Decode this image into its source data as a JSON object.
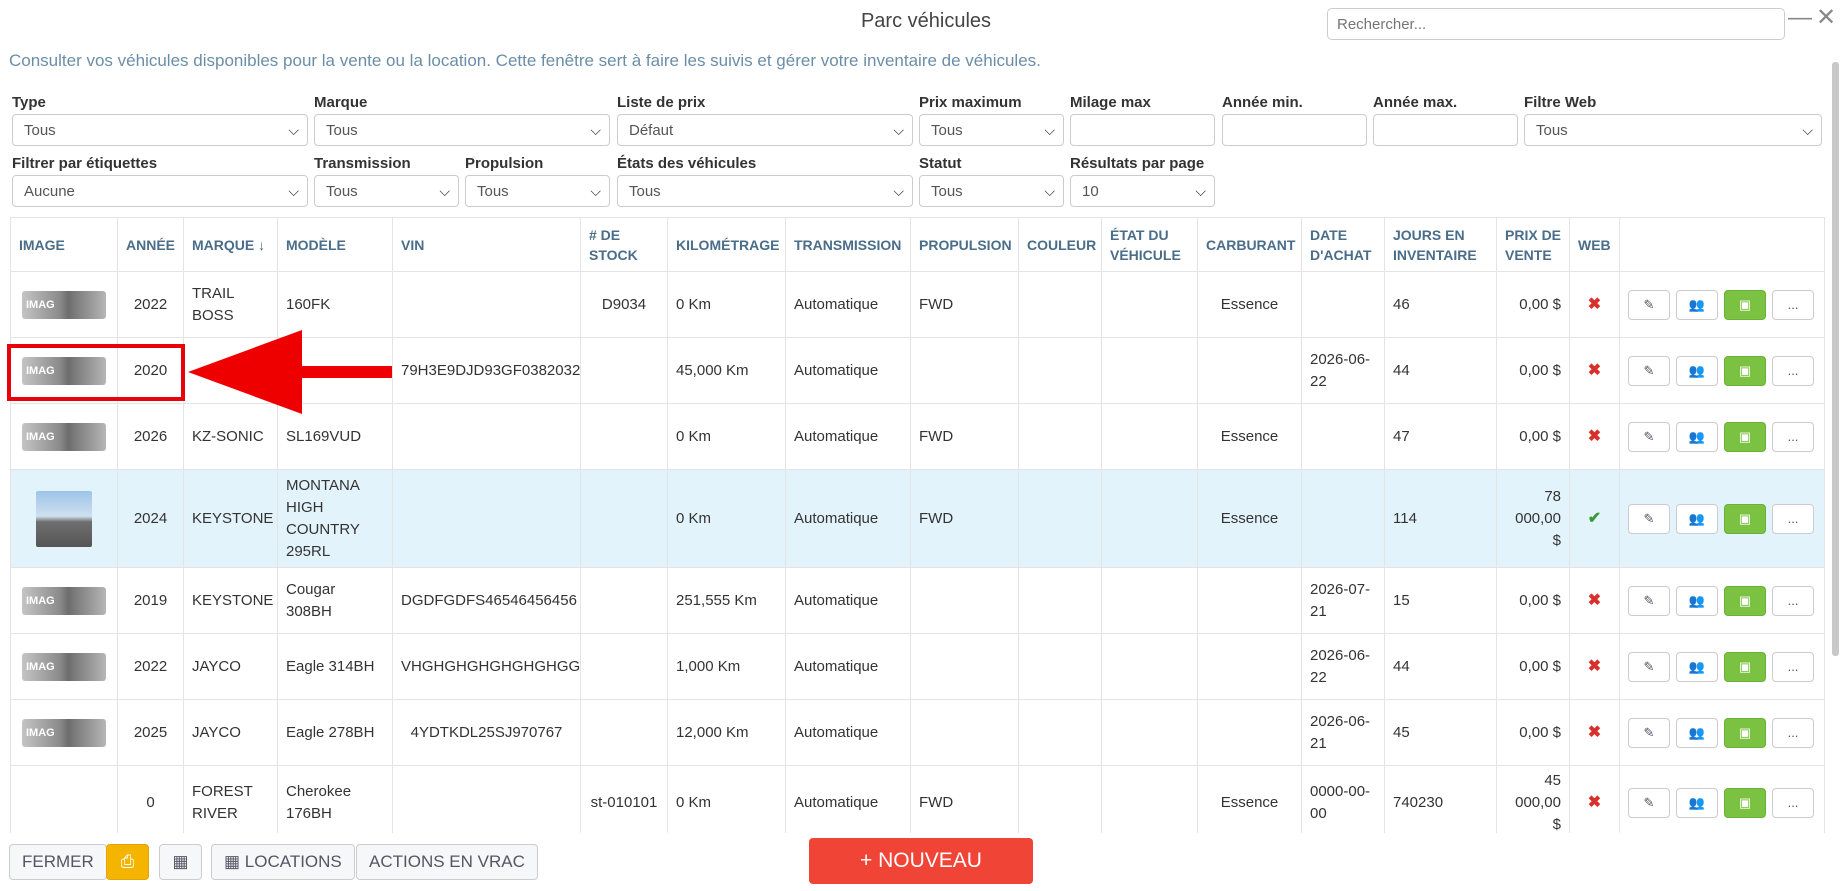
{
  "window": {
    "title": "Parc véhicules",
    "search_placeholder": "Rechercher...",
    "minimize": "—",
    "close": "✕"
  },
  "description": "Consulter vos véhicules disponibles pour la vente ou la location. Cette fenêtre sert à faire les suivis et gérer votre inventaire de véhicules.",
  "filters": {
    "type": {
      "label": "Type",
      "value": "Tous"
    },
    "marque": {
      "label": "Marque",
      "value": "Tous"
    },
    "liste_prix": {
      "label": "Liste de prix",
      "value": "Défaut"
    },
    "prix_max": {
      "label": "Prix maximum",
      "value": "Tous"
    },
    "milage_max": {
      "label": "Milage max",
      "value": ""
    },
    "annee_min": {
      "label": "Année min.",
      "value": ""
    },
    "annee_max": {
      "label": "Année max.",
      "value": ""
    },
    "filtre_web": {
      "label": "Filtre Web",
      "value": "Tous"
    },
    "etiquettes": {
      "label": "Filtrer par étiquettes",
      "value": "Aucune"
    },
    "transmission": {
      "label": "Transmission",
      "value": "Tous"
    },
    "propulsion": {
      "label": "Propulsion",
      "value": "Tous"
    },
    "etats": {
      "label": "États des véhicules",
      "value": "Tous"
    },
    "statut": {
      "label": "Statut",
      "value": "Tous"
    },
    "resultats": {
      "label": "Résultats par page",
      "value": "10"
    }
  },
  "table": {
    "headers": [
      "IMAGE",
      "ANNÉE",
      "MARQUE ↓",
      "MODÈLE",
      "VIN",
      "# DE STOCK",
      "KILOMÉTRAGE",
      "TRANSMISSION",
      "PROPULSION",
      "COULEUR",
      "ÉTAT DU VÉHICULE",
      "CARBURANT",
      "DATE D'ACHAT",
      "JOURS EN INVENTAIRE",
      "PRIX DE VENTE",
      "WEB",
      ""
    ],
    "rows": [
      {
        "image": "placeholder",
        "annee": "2022",
        "marque": "TRAIL BOSS",
        "modele": "160FK",
        "vin": "",
        "stock": "D9034",
        "km": "0 Km",
        "trans": "Automatique",
        "prop": "FWD",
        "couleur": "",
        "etat": "",
        "carb": "Essence",
        "date": "",
        "jours": "46",
        "prix": "0,00 $",
        "web": "✖"
      },
      {
        "image": "placeholder",
        "annee": "2020",
        "marque": "",
        "modele": "",
        "vin": "79H3E9DJD93GF0382032",
        "stock": "",
        "km": "45,000 Km",
        "trans": "Automatique",
        "prop": "",
        "couleur": "",
        "etat": "",
        "carb": "",
        "date": "2026-06-22",
        "jours": "44",
        "prix": "0,00 $",
        "web": "✖"
      },
      {
        "image": "placeholder",
        "annee": "2026",
        "marque": "KZ-SONIC",
        "modele": "SL169VUD",
        "vin": "",
        "stock": "",
        "km": "0 Km",
        "trans": "Automatique",
        "prop": "FWD",
        "couleur": "",
        "etat": "",
        "carb": "Essence",
        "date": "",
        "jours": "47",
        "prix": "0,00 $",
        "web": "✖"
      },
      {
        "image": "photo",
        "annee": "2024",
        "marque": "KEYSTONE",
        "modele": "MONTANA HIGH COUNTRY 295RL",
        "vin": "",
        "stock": "",
        "km": "0 Km",
        "trans": "Automatique",
        "prop": "FWD",
        "couleur": "",
        "etat": "",
        "carb": "Essence",
        "date": "",
        "jours": "114",
        "prix": "78 000,00 $",
        "web": "✔"
      },
      {
        "image": "placeholder",
        "annee": "2019",
        "marque": "KEYSTONE",
        "modele": "Cougar 308BH",
        "vin": "DGDFGDFS46546456456",
        "stock": "",
        "km": "251,555 Km",
        "trans": "Automatique",
        "prop": "",
        "couleur": "",
        "etat": "",
        "carb": "",
        "date": "2026-07-21",
        "jours": "15",
        "prix": "0,00 $",
        "web": "✖"
      },
      {
        "image": "placeholder",
        "annee": "2022",
        "marque": "JAYCO",
        "modele": "Eagle 314BH",
        "vin": "VHGHGHGHGHGHGHGG",
        "stock": "",
        "km": "1,000 Km",
        "trans": "Automatique",
        "prop": "",
        "couleur": "",
        "etat": "",
        "carb": "",
        "date": "2026-06-22",
        "jours": "44",
        "prix": "0,00 $",
        "web": "✖"
      },
      {
        "image": "placeholder",
        "annee": "2025",
        "marque": "JAYCO",
        "modele": "Eagle 278BH",
        "vin": "4YDTKDL25SJ970767",
        "stock": "",
        "km": "12,000 Km",
        "trans": "Automatique",
        "prop": "",
        "couleur": "",
        "etat": "",
        "carb": "",
        "date": "2026-06-21",
        "jours": "45",
        "prix": "0,00 $",
        "web": "✖"
      },
      {
        "image": "none",
        "annee": "0",
        "marque": "FOREST RIVER",
        "modele": "Cherokee 176BH",
        "vin": "",
        "stock": "st-010101",
        "km": "0 Km",
        "trans": "Automatique",
        "prop": "FWD",
        "couleur": "",
        "etat": "",
        "carb": "Essence",
        "date": "0000-00-00",
        "jours": "740230",
        "prix": "45 000,00 $",
        "web": "✖"
      }
    ],
    "thumb_text": "IMAG"
  },
  "row_actions": {
    "edit_icon": "pencil-icon",
    "people_icon": "users-icon",
    "money_icon": "money-icon",
    "more": "..."
  },
  "bottom": {
    "fermer": "FERMER",
    "print_icon": "print-icon",
    "calendar_icon": "calendar-icon",
    "locations": "LOCATIONS",
    "actions_vrac": "ACTIONS EN VRAC",
    "nouveau": "+ NOUVEAU"
  },
  "colors": {
    "accent_red": "#f04437",
    "green": "#7cc242",
    "yellow": "#f5b400",
    "highlight_row": "#e3f3fb",
    "annotation_red": "#e8000b"
  }
}
